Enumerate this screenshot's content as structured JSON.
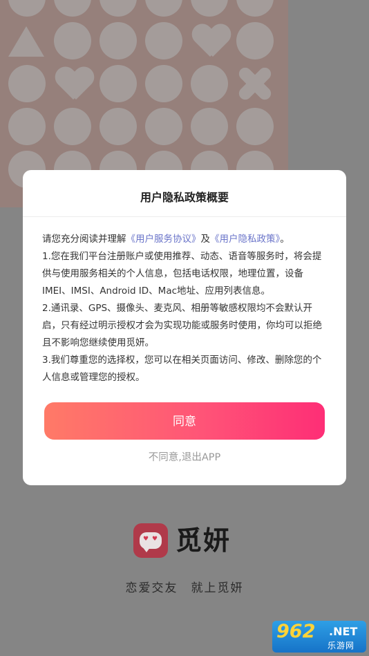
{
  "dialog": {
    "title": "用户隐私政策概要",
    "intro_prefix": "请您充分阅读并理解",
    "link_service": "《用户服务协议》",
    "and": "及",
    "link_privacy": "《用户隐私政策》",
    "intro_suffix": "。",
    "paragraph_1": "1.您在我们平台注册账户或使用推荐、动态、语音等服务时，将会提供与使用服务相关的个人信息，包括电话权限，地理位置，设备IMEI、IMSI、Android ID、Mac地址、应用列表信息。",
    "paragraph_2": "2.通讯录、GPS、摄像头、麦克风、相册等敏感权限均不会默认开启，只有经过明示授权才会为实现功能或服务时使用，你均可以拒绝且不影响您继续使用觅妍。",
    "paragraph_3": "3.我们尊重您的选择权，您可以在相关页面访问、修改、删除您的个人信息或管理您的授权。",
    "agree_label": "同意",
    "decline_label": "不同意,退出APP"
  },
  "app": {
    "name": "觅妍",
    "slogan": "恋爱交友　就上觅妍",
    "logo_icon": "heart-eyes-chat-bubble-icon"
  },
  "watermark": {
    "big": "962",
    "net": ".NET",
    "sub": "乐游网"
  },
  "colors": {
    "accent_start": "#ff7a67",
    "accent_end": "#fe2e76",
    "link": "#6a74c9"
  }
}
